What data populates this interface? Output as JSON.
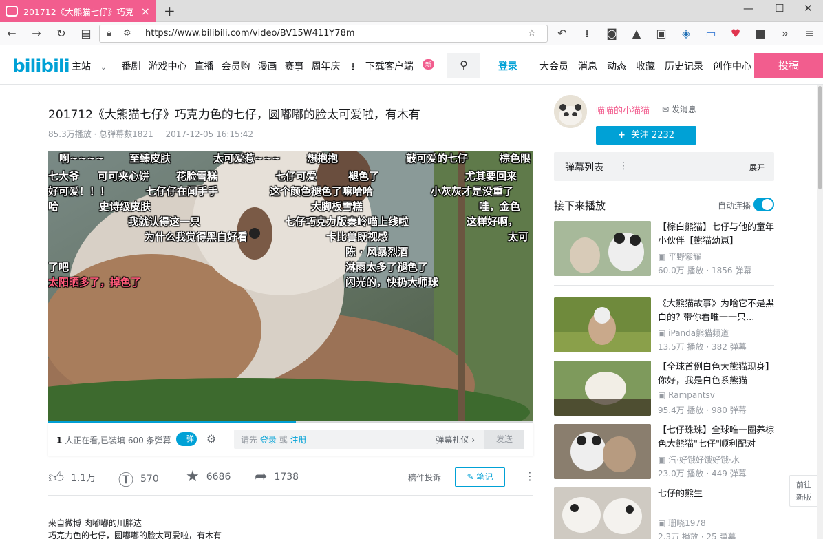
{
  "browser": {
    "tab_title": "201712《大熊猫七仔》巧克力",
    "url": "https://www.bilibili.com/video/BV15W411Y78m"
  },
  "header": {
    "logo": "bilibili",
    "nav": [
      "主站",
      "番剧",
      "游戏中心",
      "直播",
      "会员购",
      "漫画",
      "赛事",
      "周年庆",
      "下载客户端"
    ],
    "new_badge": "新",
    "login": "登录",
    "right_nav": [
      "大会员",
      "消息",
      "动态",
      "收藏",
      "历史记录",
      "创作中心"
    ],
    "upload": "投稿"
  },
  "video": {
    "title": "201712《大熊猫七仔》巧克力色的七仔，圆嘟嘟的脸太可爱啦，有木有",
    "stats": "85.3万播放 · 总弹幕数1821",
    "date": "2017-12-05 16:15:42",
    "progress": 0.51
  },
  "danmaku": [
    {
      "text": "啊~~~~",
      "color": "#ffffff"
    },
    {
      "text": "至臻皮肤",
      "color": "#ffffff"
    },
    {
      "text": "太可爱惹~~~",
      "color": "#ffffff"
    },
    {
      "text": "想抱抱",
      "color": "#ffffff"
    },
    {
      "text": "敲可爱的七仔",
      "color": "#ffffff"
    },
    {
      "text": "棕色限",
      "color": "#ffffff"
    },
    {
      "text": "七大爷",
      "color": "#ffffff"
    },
    {
      "text": "可可夹心饼",
      "color": "#ffffff"
    },
    {
      "text": "花脸雪糕",
      "color": "#ffffff"
    },
    {
      "text": "七仔可爱",
      "color": "#ffffff"
    },
    {
      "text": "褪色了",
      "color": "#ffffff"
    },
    {
      "text": "尤其要回来",
      "color": "#ffffff"
    },
    {
      "text": "好可爱！！！",
      "color": "#ffffff"
    },
    {
      "text": "七仔仔在闻手手",
      "color": "#ffffff"
    },
    {
      "text": "这个颜色褪色了嘛哈哈",
      "color": "#ffffff"
    },
    {
      "text": "小灰灰才是没重了",
      "color": "#ffffff"
    },
    {
      "text": "哈",
      "color": "#ffffff"
    },
    {
      "text": "史诗级皮肤",
      "color": "#ffffff"
    },
    {
      "text": "大脚板雪糕",
      "color": "#ffffff"
    },
    {
      "text": "哇，金色",
      "color": "#ffffff"
    },
    {
      "text": "我就认得这一只",
      "color": "#ffffff"
    },
    {
      "text": "七仔巧克力版秦岭喵上线啦",
      "color": "#ffffff"
    },
    {
      "text": "这样好啊，",
      "color": "#ffffff"
    },
    {
      "text": "为什么我觉得黑白好看",
      "color": "#ffffff"
    },
    {
      "text": "卡比兽既视感",
      "color": "#ffffff"
    },
    {
      "text": "太可",
      "color": "#ffffff"
    },
    {
      "text": "陈 · 风暴烈酒",
      "color": "#ffffff"
    },
    {
      "text": "了吧",
      "color": "#ffffff"
    },
    {
      "text": "淋雨太多了褪色了",
      "color": "#ffffff"
    },
    {
      "text": "太阳晒多了，掉色了",
      "color": "#ff5a7a"
    },
    {
      "text": "闪光的，快扔大师球",
      "color": "#ffffff"
    }
  ],
  "send_bar": {
    "watching_count": "1",
    "watching_text": "人正在看,已装填 600 条弹幕",
    "toggle_label": "弹",
    "prompt_prefix": "请先",
    "login": "登录",
    "or": "或",
    "register": "注册",
    "etiquette": "弹幕礼仪 ›",
    "send": "发送"
  },
  "actions": {
    "like": "1.1万",
    "coin": "570",
    "fav": "6686",
    "share": "1738",
    "report": "稿件投诉",
    "notes": "笔记"
  },
  "description": [
    "来自微博 肉嘟嘟的川胖达",
    "巧克力色的七仔，圆嘟嘟的脸太可爱啦，有木有"
  ],
  "uploader": {
    "name": "喵喵的小猫猫",
    "message": "发消息",
    "follow": "关注 2232"
  },
  "danmaku_list": {
    "title": "弹幕列表",
    "expand": "展开"
  },
  "next_up": {
    "title": "接下来播放",
    "autoplay": "自动连播"
  },
  "recommendations": [
    {
      "title": "【棕白熊猫】七仔与他的童年小伙伴【熊猫幼崽】",
      "up": "平野紫耀",
      "stats": "60.0万 播放 · 1856 弹幕"
    },
    {
      "title": "《大熊猫故事》为啥它不是黑白的? 带你看唯一一只...",
      "up": "iPanda熊猫频道",
      "stats": "13.5万 播放 · 382 弹幕"
    },
    {
      "title": "【全球首例白色大熊猫现身】你好，我是白色系熊猫",
      "up": "Rampantsv",
      "stats": "95.4万 播放 · 980 弹幕"
    },
    {
      "title": "【七仔珠珠】全球唯一圈养棕色大熊猫\"七仔\"顺利配对",
      "up": "汽·好饿好饿好饿·水",
      "stats": "23.0万 播放 · 449 弹幕"
    },
    {
      "title": "七仔的熊生",
      "up": "珊晓1978",
      "stats": "2.3万 播放 · 25 弹幕"
    }
  ],
  "float_button": [
    "前往",
    "新版"
  ],
  "colors": {
    "brand_pink": "#f25d8e",
    "brand_blue": "#00a1d6"
  }
}
